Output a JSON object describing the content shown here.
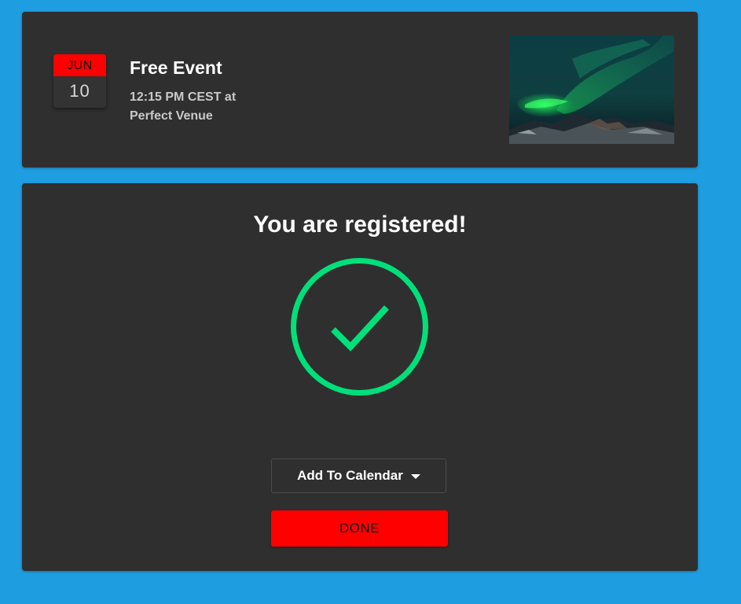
{
  "event": {
    "month": "JUN",
    "day": "10",
    "title": "Free Event",
    "time": "12:15 PM CEST at",
    "venue": "Perfect Venue",
    "image_description_icon": "aurora-image",
    "colors": {
      "badge_month_bg": "#ff0000",
      "card_bg": "#2f2f2f",
      "page_bg": "#1e9ee0"
    }
  },
  "confirmation": {
    "title": "You are registered!",
    "check_icon": "checkmark-circle-icon",
    "check_color": "#00e07a",
    "add_to_calendar_label": "Add To Calendar",
    "done_label": "DONE",
    "done_color": "#ff0000"
  }
}
